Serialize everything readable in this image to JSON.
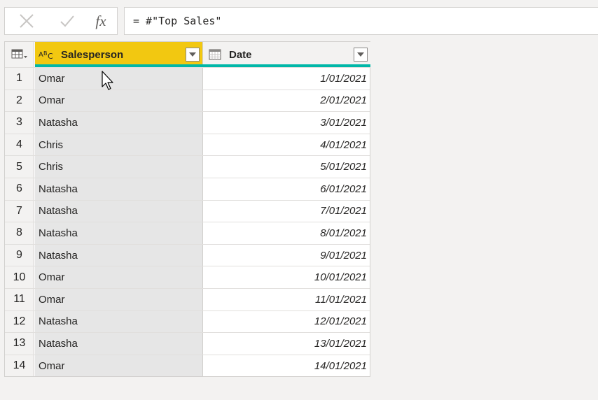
{
  "formula_bar": {
    "cancel_icon": "close-icon",
    "commit_icon": "checkmark-icon",
    "fx_label": "fx",
    "formula": "= #\"Top Sales\""
  },
  "table": {
    "columns": [
      {
        "label": "Salesperson",
        "type_icon": "text-type-icon",
        "selected": true
      },
      {
        "label": "Date",
        "type_icon": "calendar-type-icon",
        "selected": false
      }
    ],
    "rows": [
      {
        "num": "1",
        "salesperson": "Omar",
        "date": "1/01/2021"
      },
      {
        "num": "2",
        "salesperson": "Omar",
        "date": "2/01/2021"
      },
      {
        "num": "3",
        "salesperson": "Natasha",
        "date": "3/01/2021"
      },
      {
        "num": "4",
        "salesperson": "Chris",
        "date": "4/01/2021"
      },
      {
        "num": "5",
        "salesperson": "Chris",
        "date": "5/01/2021"
      },
      {
        "num": "6",
        "salesperson": "Natasha",
        "date": "6/01/2021"
      },
      {
        "num": "7",
        "salesperson": "Natasha",
        "date": "7/01/2021"
      },
      {
        "num": "8",
        "salesperson": "Natasha",
        "date": "8/01/2021"
      },
      {
        "num": "9",
        "salesperson": "Natasha",
        "date": "9/01/2021"
      },
      {
        "num": "10",
        "salesperson": "Omar",
        "date": "10/01/2021"
      },
      {
        "num": "11",
        "salesperson": "Omar",
        "date": "11/01/2021"
      },
      {
        "num": "12",
        "salesperson": "Natasha",
        "date": "12/01/2021"
      },
      {
        "num": "13",
        "salesperson": "Natasha",
        "date": "13/01/2021"
      },
      {
        "num": "14",
        "salesperson": "Omar",
        "date": "14/01/2021"
      }
    ]
  },
  "colors": {
    "selected_header": "#f2c811",
    "quality_bar": "#00b7a8",
    "selected_column": "#e6e6e6"
  }
}
